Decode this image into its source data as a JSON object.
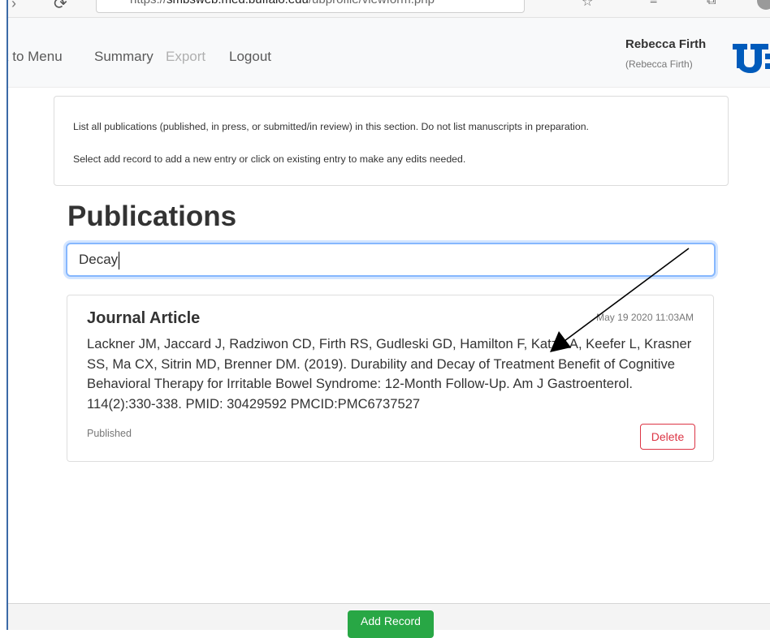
{
  "browser": {
    "url_prefix": "https://",
    "url_domain": "smbsweb.med.buffalo.edu",
    "url_path": "/ubprofile/viewform.php"
  },
  "nav": {
    "links": [
      "k to Menu",
      "Summary",
      "Export",
      "Logout"
    ],
    "user_name": "Rebecca Firth",
    "user_sub": "(Rebecca Firth)"
  },
  "info": {
    "line1": "List all publications (published, in press, or submitted/in review) in this section. Do not list manuscripts in preparation.",
    "line2": "Select add record to add a new entry or click on existing entry to make any edits needed."
  },
  "page_title": "Publications",
  "search": {
    "value": "Decay",
    "placeholder": ""
  },
  "record": {
    "type": "Journal Article",
    "date": "May 19 2020 11:03AM",
    "citation": "Lackner JM, Jaccard J, Radziwon CD, Firth RS, Gudleski GD, Hamilton F, Katz LA, Keefer L, Krasner SS, Ma CX, Sitrin MD, Brenner DM. (2019). Durability and Decay of Treatment Benefit of Cognitive Behavioral Therapy for Irritable Bowel Syndrome: 12-Month Follow-Up. Am J Gastroenterol. 114(2):330-338. PMID: 30429592 PMCID:PMC6737527",
    "status": "Published",
    "delete_label": "Delete"
  },
  "footer": {
    "add_label": "Add Record"
  },
  "colors": {
    "success": "#28a745",
    "danger": "#dc3545",
    "focus_border": "#86b7fe",
    "logo_blue": "#005bbb",
    "annotation_arrow": "#000000"
  },
  "icons": [
    "back-arrow-icon",
    "refresh-icon",
    "star-icon",
    "favorites-icon",
    "collections-icon",
    "profile-icon",
    "ub-logo",
    "annotation-arrow"
  ]
}
